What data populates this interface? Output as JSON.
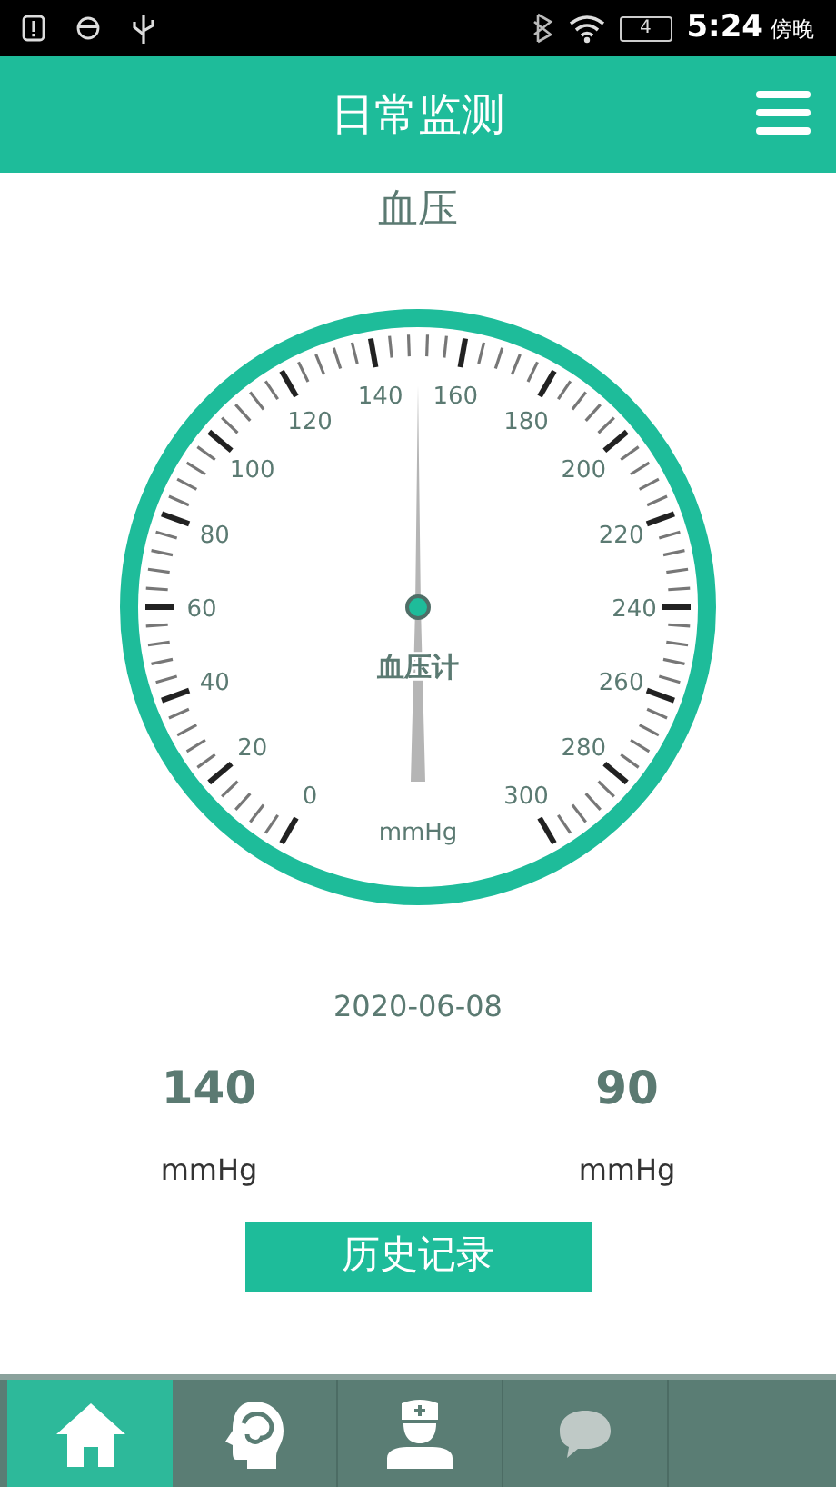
{
  "status_bar": {
    "battery": "4",
    "time": "5:24",
    "period": "傍晚"
  },
  "header": {
    "title": "日常监测"
  },
  "section_title": "血压",
  "gauge": {
    "labels": [
      "0",
      "20",
      "40",
      "60",
      "80",
      "100",
      "120",
      "140",
      "160",
      "180",
      "200",
      "220",
      "240",
      "260",
      "280",
      "300"
    ],
    "center_label": "血压计",
    "unit": "mmHg"
  },
  "date": "2020-06-08",
  "readings": [
    {
      "value": "140",
      "unit": "mmHg"
    },
    {
      "value": "90",
      "unit": "mmHg"
    }
  ],
  "history_button": "历史记录",
  "tabs": [
    {
      "selected": true
    },
    {
      "selected": false
    },
    {
      "selected": false
    },
    {
      "selected": false
    }
  ]
}
